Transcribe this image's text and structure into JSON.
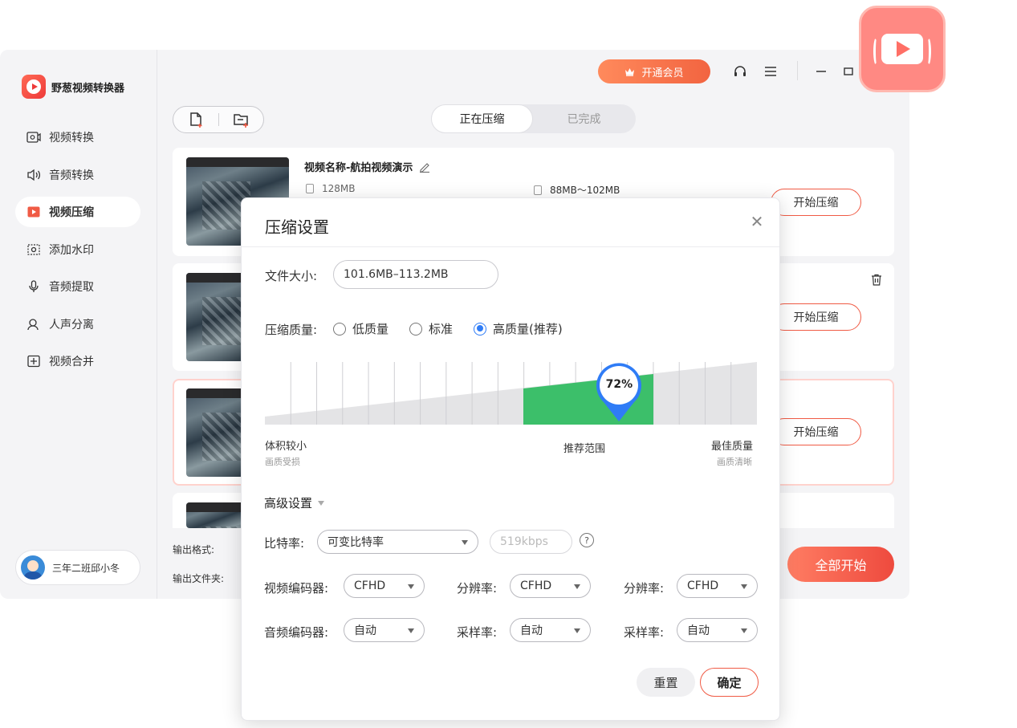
{
  "brand": {
    "name": "野葱视频转换器"
  },
  "sidebar": {
    "items": [
      {
        "label": "视频转换",
        "icon": "video-convert-icon",
        "active": false
      },
      {
        "label": "音频转换",
        "icon": "audio-convert-icon",
        "active": false
      },
      {
        "label": "视频压缩",
        "icon": "video-compress-icon",
        "active": true
      },
      {
        "label": "添加水印",
        "icon": "watermark-icon",
        "active": false
      },
      {
        "label": "音频提取",
        "icon": "audio-extract-icon",
        "active": false
      },
      {
        "label": "人声分离",
        "icon": "voice-separate-icon",
        "active": false
      },
      {
        "label": "视频合并",
        "icon": "video-merge-icon",
        "active": false
      }
    ],
    "user": {
      "name": "三年二班邱小冬"
    }
  },
  "topbar": {
    "vip_label": "开通会员"
  },
  "tabs": [
    {
      "label": "正在压缩",
      "active": true
    },
    {
      "label": "已完成",
      "active": false
    }
  ],
  "files": [
    {
      "name": "视频名称-航拍视频演示",
      "src_size": "128MB",
      "out_size": "88MB～102MB",
      "action": "开始压缩"
    },
    {
      "action": "开始压缩"
    },
    {
      "action": "开始压缩"
    }
  ],
  "bottom": {
    "format_label": "输出格式:",
    "folder_label": "输出文件夹:",
    "start_all": "全部开始"
  },
  "dialog": {
    "title": "压缩设置",
    "file_size_label": "文件大小:",
    "file_size_value": "101.6MB–113.2MB",
    "quality_label": "压缩质量:",
    "quality_options": [
      {
        "label": "低质量",
        "checked": false
      },
      {
        "label": "标准",
        "checked": false
      },
      {
        "label": "高质量(推荐)",
        "checked": true
      }
    ],
    "slider": {
      "value_percent": 72,
      "value_label": "72%",
      "left_label": "体积较小",
      "left_sub": "画质受损",
      "mid_label": "推荐范围",
      "right_label": "最佳质量",
      "right_sub": "画质清晰"
    },
    "advanced": {
      "title": "高级设置",
      "bitrate_label": "比特率:",
      "bitrate_mode": "可变比特率",
      "bitrate_value": "519kbps",
      "help": "?",
      "video_codec_label": "视频编码器:",
      "video_codec": "CFHD",
      "resolution_label": "分辨率:",
      "resolution_1": "CFHD",
      "resolution_2": "CFHD",
      "audio_codec_label": "音频编码器:",
      "audio_codec": "自动",
      "sample_rate_label": "采样率:",
      "sample_rate_1": "自动",
      "sample_rate_2": "自动"
    },
    "reset_label": "重置",
    "ok_label": "确定"
  },
  "colors": {
    "accent": "#f05b45",
    "radio": "#2f7cf6",
    "recommended": "#3cbf6a"
  }
}
